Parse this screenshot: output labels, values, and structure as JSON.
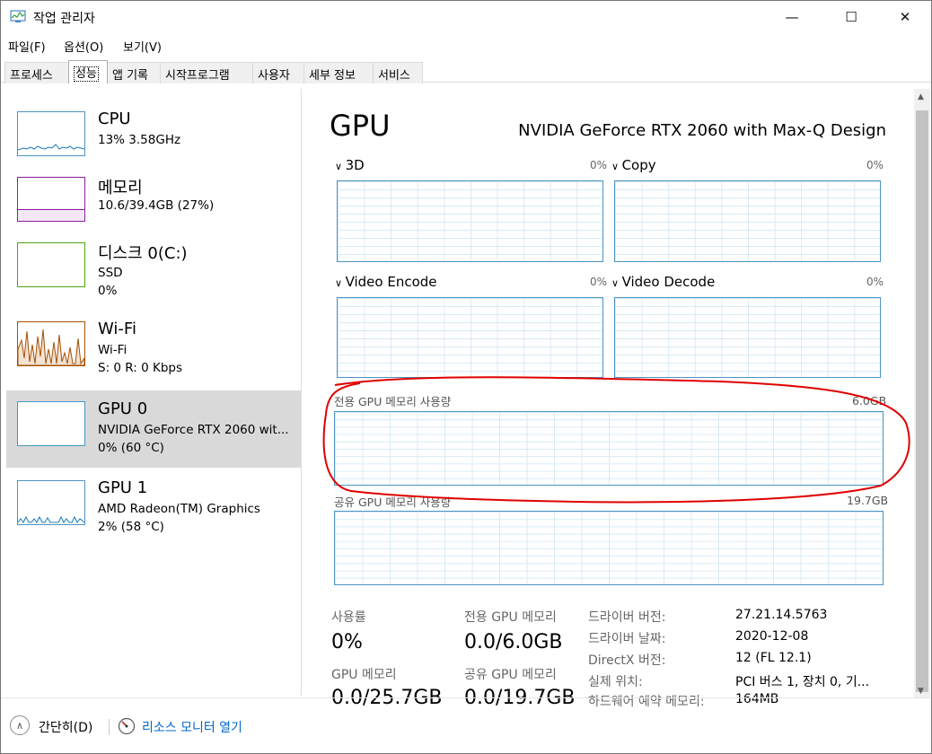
{
  "window": {
    "title": "작업 관리자",
    "minimize": "—",
    "maximize": "☐",
    "close": "✕"
  },
  "menu": [
    "파일(F)",
    "옵션(O)",
    "보기(V)"
  ],
  "tabs": [
    "프로세스",
    "성능",
    "앱 기록",
    "시작프로그램",
    "사용자",
    "세부 정보",
    "서비스"
  ],
  "active_tab": "성능",
  "sidebar": [
    {
      "name": "CPU",
      "line1": "13% 3.58GHz",
      "line2": "",
      "color": "#1779ba"
    },
    {
      "name": "메모리",
      "line1": "10.6/39.4GB (27%)",
      "line2": "",
      "color": "#8b1e9b"
    },
    {
      "name": "디스크 0(C:)",
      "line1": "SSD",
      "line2": "0%",
      "color": "#4da60c"
    },
    {
      "name": "Wi-Fi",
      "line1": "Wi-Fi",
      "line2": "S: 0 R: 0 Kbps",
      "color": "#a74f01"
    },
    {
      "name": "GPU 0",
      "line1": "NVIDIA GeForce RTX 2060 wit...",
      "line2": "0% (60 °C)",
      "color": "#1779ba",
      "selected": true
    },
    {
      "name": "GPU 1",
      "line1": "AMD Radeon(TM) Graphics",
      "line2": "2% (58 °C)",
      "color": "#1779ba"
    }
  ],
  "main": {
    "title": "GPU",
    "model": "NVIDIA GeForce RTX 2060 with Max-Q Design",
    "engines": [
      {
        "label": "3D",
        "pct": "0%"
      },
      {
        "label": "Copy",
        "pct": "0%"
      },
      {
        "label": "Video Encode",
        "pct": "0%"
      },
      {
        "label": "Video Decode",
        "pct": "0%"
      }
    ],
    "dedicated_label": "전용 GPU 메모리 사용량",
    "dedicated_max": "6.0GB",
    "shared_label": "공유 GPU 메모리 사용량",
    "shared_max": "19.7GB",
    "stats": [
      {
        "label": "사용률",
        "value": "0%"
      },
      {
        "label": "전용 GPU 메모리",
        "value": "0.0/6.0GB"
      },
      {
        "label": "GPU 메모리",
        "value": "0.0/25.7GB"
      },
      {
        "label": "공유 GPU 메모리",
        "value": "0.0/19.7GB"
      }
    ],
    "info": [
      {
        "label": "드라이버 버전:",
        "value": "27.21.14.5763"
      },
      {
        "label": "드라이버 날짜:",
        "value": "2020-12-08"
      },
      {
        "label": "DirectX 버전:",
        "value": "12 (FL 12.1)"
      },
      {
        "label": "실제 위치:",
        "value": "PCI 버스 1, 장치 0, 기..."
      },
      {
        "label": "하드웨어 예약 메모리:",
        "value": "164MB"
      }
    ]
  },
  "footer": {
    "collapse": "간단히(D)",
    "monitor": "리소스 모니터 열기"
  }
}
